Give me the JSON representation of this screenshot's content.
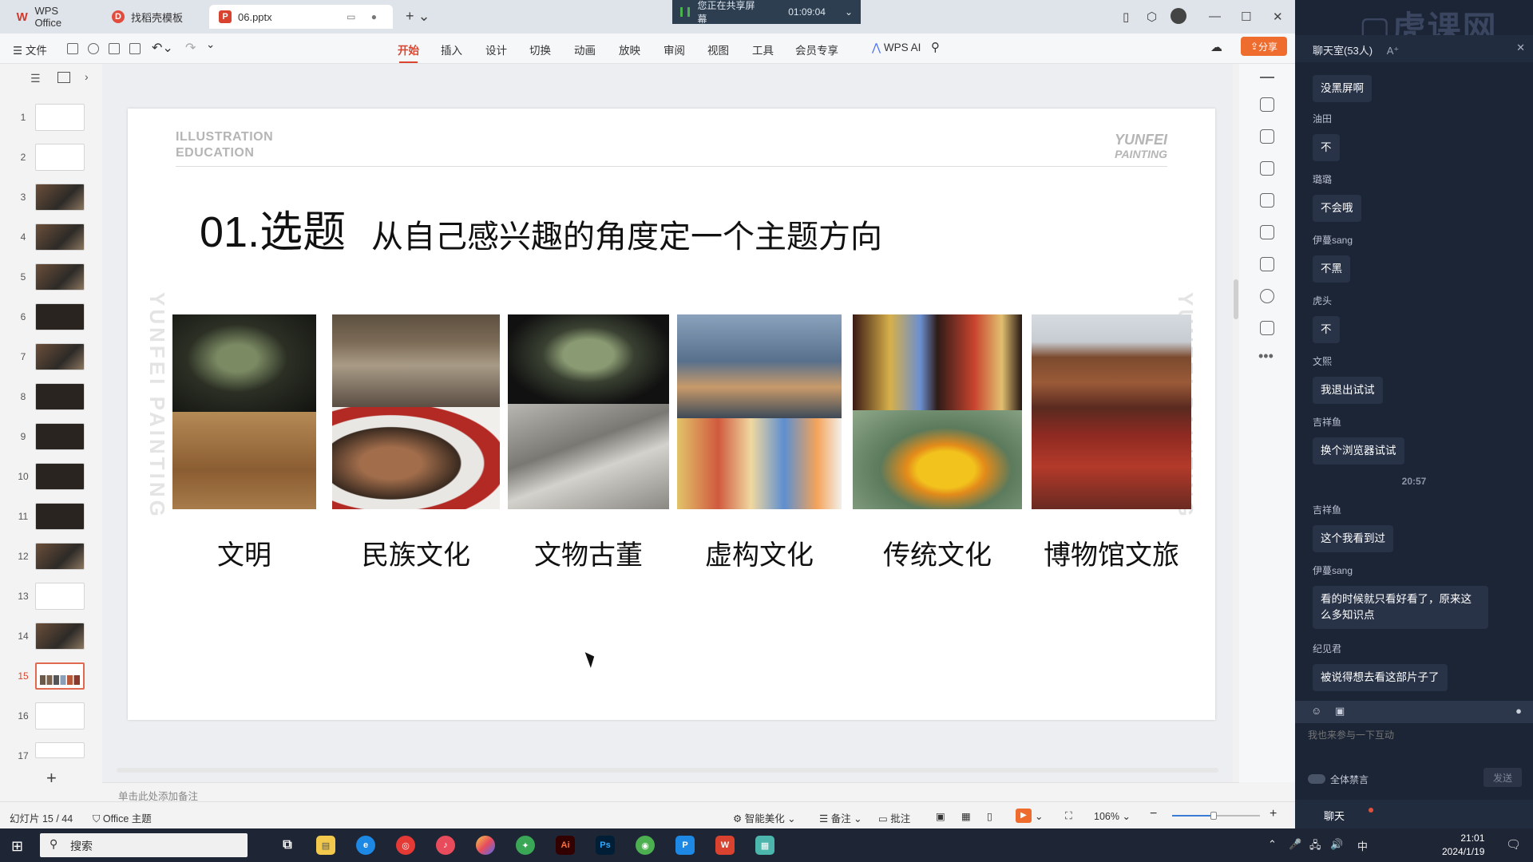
{
  "tabs": {
    "wps_label": "WPS Office",
    "template_label": "找稻壳模板",
    "file_label": "06.pptx"
  },
  "share_banner": {
    "text": "您正在共享屏幕",
    "timer": "01:09:04"
  },
  "ribbon": {
    "file_menu": "文件",
    "items": [
      "开始",
      "插入",
      "设计",
      "切换",
      "动画",
      "放映",
      "审阅",
      "视图",
      "工具",
      "会员专享"
    ],
    "ai_label": "WPS AI",
    "share_label": "分享"
  },
  "thumbnails": [
    "1",
    "2",
    "3",
    "4",
    "5",
    "6",
    "7",
    "8",
    "9",
    "10",
    "11",
    "12",
    "13",
    "14",
    "15",
    "16",
    "17"
  ],
  "slide": {
    "brand_left_1": "ILLUSTRATION",
    "brand_left_2": "EDUCATION",
    "brand_right_1": "YUNFEI",
    "brand_right_2": "PAINTING",
    "watermark": "YUNFEI PAINTING",
    "heading": "01.选题",
    "subtitle": "从自己感兴趣的角度定一个主题方向",
    "categories": [
      "文明",
      "民族文化",
      "文物古董",
      "虚构文化",
      "传统文化",
      "博物馆文旅"
    ]
  },
  "notes_placeholder": "单击此处添加备注",
  "status": {
    "slide_counter": "幻灯片 15 / 44",
    "theme": "Office 主题",
    "beautify": "智能美化",
    "notes": "备注",
    "comments": "批注",
    "zoom": "106%"
  },
  "chat": {
    "title": "聊天室(53人)",
    "font_toggle": "A⁺",
    "messages": [
      {
        "name": "",
        "text": "没黑屏啊"
      },
      {
        "name": "油田",
        "text": "不"
      },
      {
        "name": "璐璐",
        "text": "不会哦"
      },
      {
        "name": "伊蔓sang",
        "text": "不黑"
      },
      {
        "name": "虎头",
        "text": "不"
      },
      {
        "name": "文熙",
        "text": "我退出试试"
      },
      {
        "name": "吉祥鱼",
        "text": "换个浏览器试试"
      },
      {
        "name": "吉祥鱼",
        "text": "这个我看到过"
      },
      {
        "name": "伊蔓sang",
        "text": "看的时候就只看好看了，原来这么多知识点"
      },
      {
        "name": "纪见君",
        "text": "被说得想去看这部片子了"
      }
    ],
    "time_divider": "20:57",
    "input_placeholder": "我也来参与一下互动",
    "mute_label": "全体禁言",
    "send_label": "发送",
    "tab_chat": "聊天"
  },
  "taskbar": {
    "search_label": "搜索",
    "time": "21:01",
    "date": "2024/1/19",
    "ime": "中"
  },
  "colors": {
    "accent": "#d9462f",
    "share_button": "#ef6c2f",
    "chat_bg": "#1c2536",
    "taskbar_bg": "#1e2535"
  }
}
